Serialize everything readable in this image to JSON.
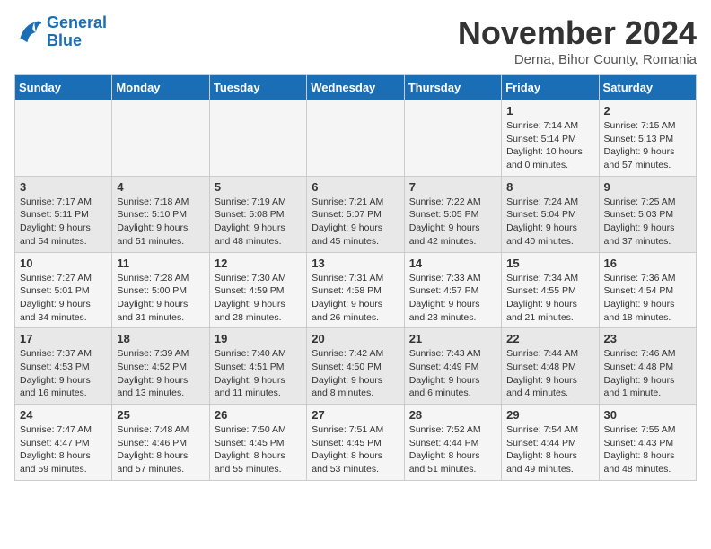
{
  "logo": {
    "line1": "General",
    "line2": "Blue"
  },
  "title": "November 2024",
  "location": "Derna, Bihor County, Romania",
  "weekdays": [
    "Sunday",
    "Monday",
    "Tuesday",
    "Wednesday",
    "Thursday",
    "Friday",
    "Saturday"
  ],
  "weeks": [
    [
      {
        "num": "",
        "content": ""
      },
      {
        "num": "",
        "content": ""
      },
      {
        "num": "",
        "content": ""
      },
      {
        "num": "",
        "content": ""
      },
      {
        "num": "",
        "content": ""
      },
      {
        "num": "1",
        "content": "Sunrise: 7:14 AM\nSunset: 5:14 PM\nDaylight: 10 hours\nand 0 minutes."
      },
      {
        "num": "2",
        "content": "Sunrise: 7:15 AM\nSunset: 5:13 PM\nDaylight: 9 hours\nand 57 minutes."
      }
    ],
    [
      {
        "num": "3",
        "content": "Sunrise: 7:17 AM\nSunset: 5:11 PM\nDaylight: 9 hours\nand 54 minutes."
      },
      {
        "num": "4",
        "content": "Sunrise: 7:18 AM\nSunset: 5:10 PM\nDaylight: 9 hours\nand 51 minutes."
      },
      {
        "num": "5",
        "content": "Sunrise: 7:19 AM\nSunset: 5:08 PM\nDaylight: 9 hours\nand 48 minutes."
      },
      {
        "num": "6",
        "content": "Sunrise: 7:21 AM\nSunset: 5:07 PM\nDaylight: 9 hours\nand 45 minutes."
      },
      {
        "num": "7",
        "content": "Sunrise: 7:22 AM\nSunset: 5:05 PM\nDaylight: 9 hours\nand 42 minutes."
      },
      {
        "num": "8",
        "content": "Sunrise: 7:24 AM\nSunset: 5:04 PM\nDaylight: 9 hours\nand 40 minutes."
      },
      {
        "num": "9",
        "content": "Sunrise: 7:25 AM\nSunset: 5:03 PM\nDaylight: 9 hours\nand 37 minutes."
      }
    ],
    [
      {
        "num": "10",
        "content": "Sunrise: 7:27 AM\nSunset: 5:01 PM\nDaylight: 9 hours\nand 34 minutes."
      },
      {
        "num": "11",
        "content": "Sunrise: 7:28 AM\nSunset: 5:00 PM\nDaylight: 9 hours\nand 31 minutes."
      },
      {
        "num": "12",
        "content": "Sunrise: 7:30 AM\nSunset: 4:59 PM\nDaylight: 9 hours\nand 28 minutes."
      },
      {
        "num": "13",
        "content": "Sunrise: 7:31 AM\nSunset: 4:58 PM\nDaylight: 9 hours\nand 26 minutes."
      },
      {
        "num": "14",
        "content": "Sunrise: 7:33 AM\nSunset: 4:57 PM\nDaylight: 9 hours\nand 23 minutes."
      },
      {
        "num": "15",
        "content": "Sunrise: 7:34 AM\nSunset: 4:55 PM\nDaylight: 9 hours\nand 21 minutes."
      },
      {
        "num": "16",
        "content": "Sunrise: 7:36 AM\nSunset: 4:54 PM\nDaylight: 9 hours\nand 18 minutes."
      }
    ],
    [
      {
        "num": "17",
        "content": "Sunrise: 7:37 AM\nSunset: 4:53 PM\nDaylight: 9 hours\nand 16 minutes."
      },
      {
        "num": "18",
        "content": "Sunrise: 7:39 AM\nSunset: 4:52 PM\nDaylight: 9 hours\nand 13 minutes."
      },
      {
        "num": "19",
        "content": "Sunrise: 7:40 AM\nSunset: 4:51 PM\nDaylight: 9 hours\nand 11 minutes."
      },
      {
        "num": "20",
        "content": "Sunrise: 7:42 AM\nSunset: 4:50 PM\nDaylight: 9 hours\nand 8 minutes."
      },
      {
        "num": "21",
        "content": "Sunrise: 7:43 AM\nSunset: 4:49 PM\nDaylight: 9 hours\nand 6 minutes."
      },
      {
        "num": "22",
        "content": "Sunrise: 7:44 AM\nSunset: 4:48 PM\nDaylight: 9 hours\nand 4 minutes."
      },
      {
        "num": "23",
        "content": "Sunrise: 7:46 AM\nSunset: 4:48 PM\nDaylight: 9 hours\nand 1 minute."
      }
    ],
    [
      {
        "num": "24",
        "content": "Sunrise: 7:47 AM\nSunset: 4:47 PM\nDaylight: 8 hours\nand 59 minutes."
      },
      {
        "num": "25",
        "content": "Sunrise: 7:48 AM\nSunset: 4:46 PM\nDaylight: 8 hours\nand 57 minutes."
      },
      {
        "num": "26",
        "content": "Sunrise: 7:50 AM\nSunset: 4:45 PM\nDaylight: 8 hours\nand 55 minutes."
      },
      {
        "num": "27",
        "content": "Sunrise: 7:51 AM\nSunset: 4:45 PM\nDaylight: 8 hours\nand 53 minutes."
      },
      {
        "num": "28",
        "content": "Sunrise: 7:52 AM\nSunset: 4:44 PM\nDaylight: 8 hours\nand 51 minutes."
      },
      {
        "num": "29",
        "content": "Sunrise: 7:54 AM\nSunset: 4:44 PM\nDaylight: 8 hours\nand 49 minutes."
      },
      {
        "num": "30",
        "content": "Sunrise: 7:55 AM\nSunset: 4:43 PM\nDaylight: 8 hours\nand 48 minutes."
      }
    ]
  ]
}
